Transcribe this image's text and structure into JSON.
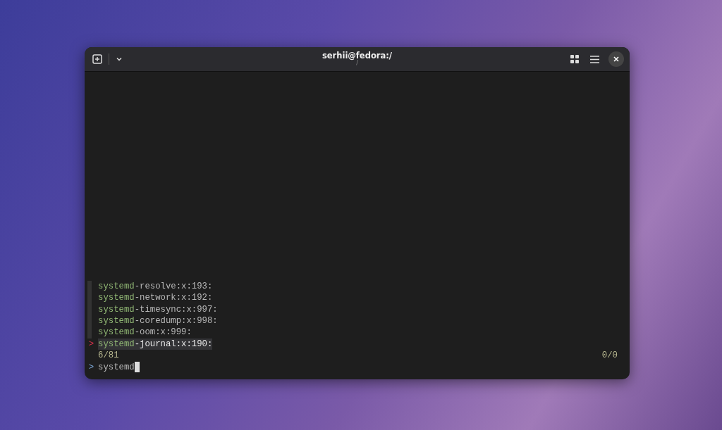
{
  "window": {
    "title": "serhii@fedora:/",
    "subtitle": "/"
  },
  "results": [
    {
      "match": "systemd",
      "rest": "-resolve:x:193:",
      "selected": false
    },
    {
      "match": "systemd",
      "rest": "-network:x:192:",
      "selected": false
    },
    {
      "match": "systemd",
      "rest": "-timesync:x:997:",
      "selected": false
    },
    {
      "match": "systemd",
      "rest": "-coredump:x:998:",
      "selected": false
    },
    {
      "match": "systemd",
      "rest": "-oom:x:999:",
      "selected": false
    },
    {
      "match": "systemd",
      "rest": "-journal:x:190:",
      "selected": true
    }
  ],
  "pointer": ">",
  "count": "6/81",
  "selection_count": "0/0",
  "prompt": {
    "symbol": ">",
    "value": "systemd"
  }
}
